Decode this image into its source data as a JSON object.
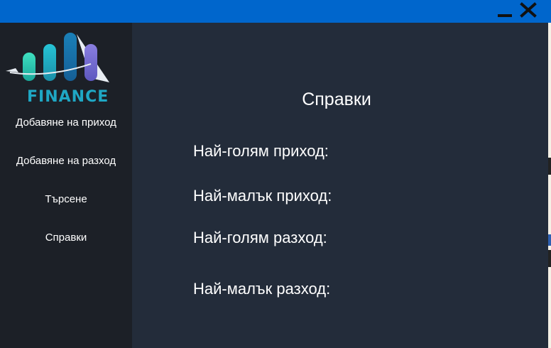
{
  "window": {
    "minimize_icon": "minimize-icon",
    "close_icon": "close-icon",
    "titlebar_color": "#0066cc"
  },
  "sidebar": {
    "logo_text": "FINANCE",
    "items": [
      {
        "label": "Добавяне на приход"
      },
      {
        "label": "Добавяне на разход"
      },
      {
        "label": "Търсене"
      },
      {
        "label": "Справки"
      }
    ]
  },
  "main": {
    "title": "Справки",
    "reports": [
      {
        "label": "Най-голям приход:"
      },
      {
        "label": "Най-малък приход:"
      },
      {
        "label": "Най-голям разход:"
      },
      {
        "label": "Най-малък разход:"
      }
    ]
  },
  "colors": {
    "sidebar_bg": "#1c2027",
    "main_bg": "#232c3a",
    "text": "#ffffff",
    "logo_accent": "#1fa7c4"
  }
}
